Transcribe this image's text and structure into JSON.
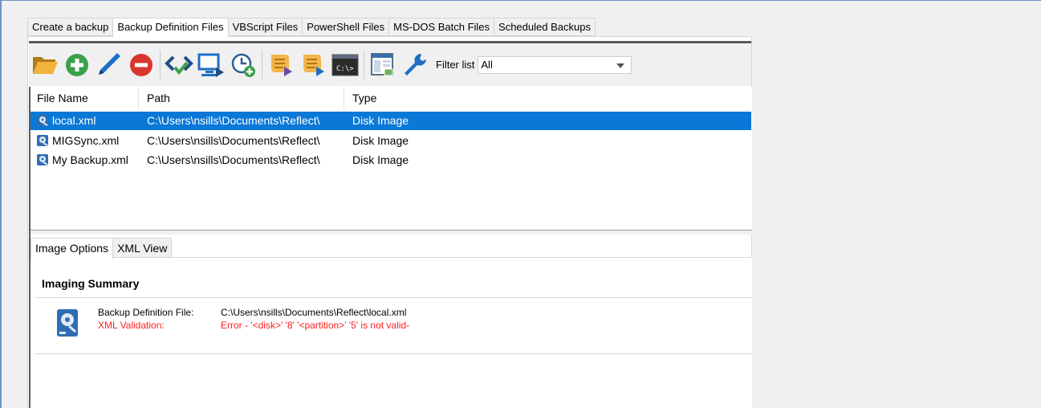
{
  "tabs": [
    {
      "label": "Create a backup"
    },
    {
      "label": "Backup Definition Files"
    },
    {
      "label": "VBScript Files"
    },
    {
      "label": "PowerShell Files"
    },
    {
      "label": "MS-DOS Batch Files"
    },
    {
      "label": "Scheduled Backups"
    }
  ],
  "toolbar": {
    "filter_label": "Filter list",
    "filter_value": "All",
    "icons": [
      "folder-open-icon",
      "add-icon",
      "edit-pencil-icon",
      "remove-icon",
      "validate-xml-icon",
      "run-now-icon",
      "schedule-icon",
      "generate-vbscript-icon",
      "generate-powershell-icon",
      "generate-batch-icon",
      "view-layout-icon",
      "settings-wrench-icon"
    ]
  },
  "list": {
    "columns": [
      "File Name",
      "Path",
      "Type"
    ],
    "rows": [
      {
        "name": "local.xml",
        "path": "C:\\Users\\nsills\\Documents\\Reflect\\",
        "type": "Disk Image",
        "selected": true
      },
      {
        "name": "MIGSync.xml",
        "path": "C:\\Users\\nsills\\Documents\\Reflect\\",
        "type": "Disk Image",
        "selected": false
      },
      {
        "name": "My Backup.xml",
        "path": "C:\\Users\\nsills\\Documents\\Reflect\\",
        "type": "Disk Image",
        "selected": false
      }
    ]
  },
  "bottom_tabs": [
    {
      "label": "Image Options"
    },
    {
      "label": "XML View"
    }
  ],
  "summary": {
    "title": "Imaging Summary",
    "definition_label": "Backup Definition File:",
    "definition_value": "C:\\Users\\nsills\\Documents\\Reflect\\local.xml",
    "validation_label": "XML Validation:",
    "validation_value": "Error - '<disk>' '8' '<partition>' '5' is not valid-"
  },
  "colors": {
    "selection": "#0a78d7",
    "error": "#ff2020",
    "accent_green": "#3aa14a",
    "accent_red": "#d9352e",
    "accent_blue": "#1e6fc4"
  }
}
